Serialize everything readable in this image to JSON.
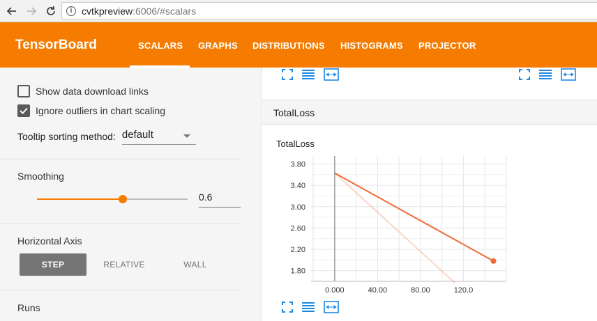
{
  "browser": {
    "url_host": "cvtkpreview",
    "url_rest": ":6006/#scalars"
  },
  "header": {
    "brand": "TensorBoard",
    "tabs": [
      "SCALARS",
      "GRAPHS",
      "DISTRIBUTIONS",
      "HISTOGRAMS",
      "PROJECTOR"
    ],
    "active_tab": "SCALARS",
    "color": "#f57c00"
  },
  "sidebar": {
    "show_download_label": "Show data download links",
    "show_download_checked": false,
    "ignore_outliers_label": "Ignore outliers in chart scaling",
    "ignore_outliers_checked": true,
    "tooltip_label": "Tooltip sorting method:",
    "tooltip_value": "default",
    "smoothing_label": "Smoothing",
    "smoothing_value": "0.6",
    "smoothing_fraction": 0.6,
    "horizontal_axis_label": "Horizontal Axis",
    "axis_options": [
      "STEP",
      "RELATIVE",
      "WALL"
    ],
    "axis_selected": "STEP",
    "runs_label": "Runs"
  },
  "main": {
    "card_title": "TotalLoss",
    "chart_title": "TotalLoss"
  },
  "chart_data": {
    "type": "line",
    "title": "TotalLoss",
    "xlabel": "",
    "ylabel": "",
    "x_ticks": [
      "0.000",
      "40.00",
      "80.00",
      "120.0"
    ],
    "y_ticks": [
      "3.80",
      "3.40",
      "3.00",
      "2.60",
      "2.20",
      "1.80"
    ],
    "xlim": [
      -22,
      160
    ],
    "ylim": [
      1.6,
      3.95
    ],
    "grid": true,
    "series": [
      {
        "color": "#f4a582",
        "opacity": 0.45,
        "x": [
          0,
          112
        ],
        "y": [
          3.63,
          1.57
        ]
      },
      {
        "color": "#ef6c3a",
        "opacity": 1.0,
        "x": [
          0,
          148
        ],
        "y": [
          3.63,
          1.98
        ],
        "end_marker": true
      }
    ]
  }
}
